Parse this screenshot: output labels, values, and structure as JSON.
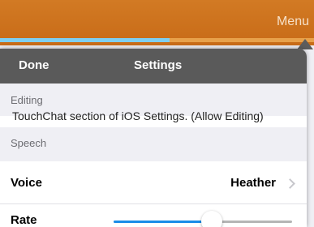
{
  "app_bar": {
    "menu_label": "Menu",
    "accent": "#c86b17"
  },
  "progress": {
    "fraction": 0.54,
    "fill_color": "#7fcff0"
  },
  "nav": {
    "done_label": "Done",
    "title": "Settings",
    "bar_color": "#5a5a5a"
  },
  "sections": {
    "editing": {
      "header": "Editing",
      "partial_text": "TouchChat section of iOS Settings. (Allow Editing)"
    },
    "speech": {
      "header": "Speech"
    }
  },
  "voice_row": {
    "label": "Voice",
    "value": "Heather",
    "icon": "chevron-right-icon"
  },
  "rate_row": {
    "label": "Rate",
    "slider_fraction": 0.55,
    "slider_color": "#1a8ce8"
  }
}
